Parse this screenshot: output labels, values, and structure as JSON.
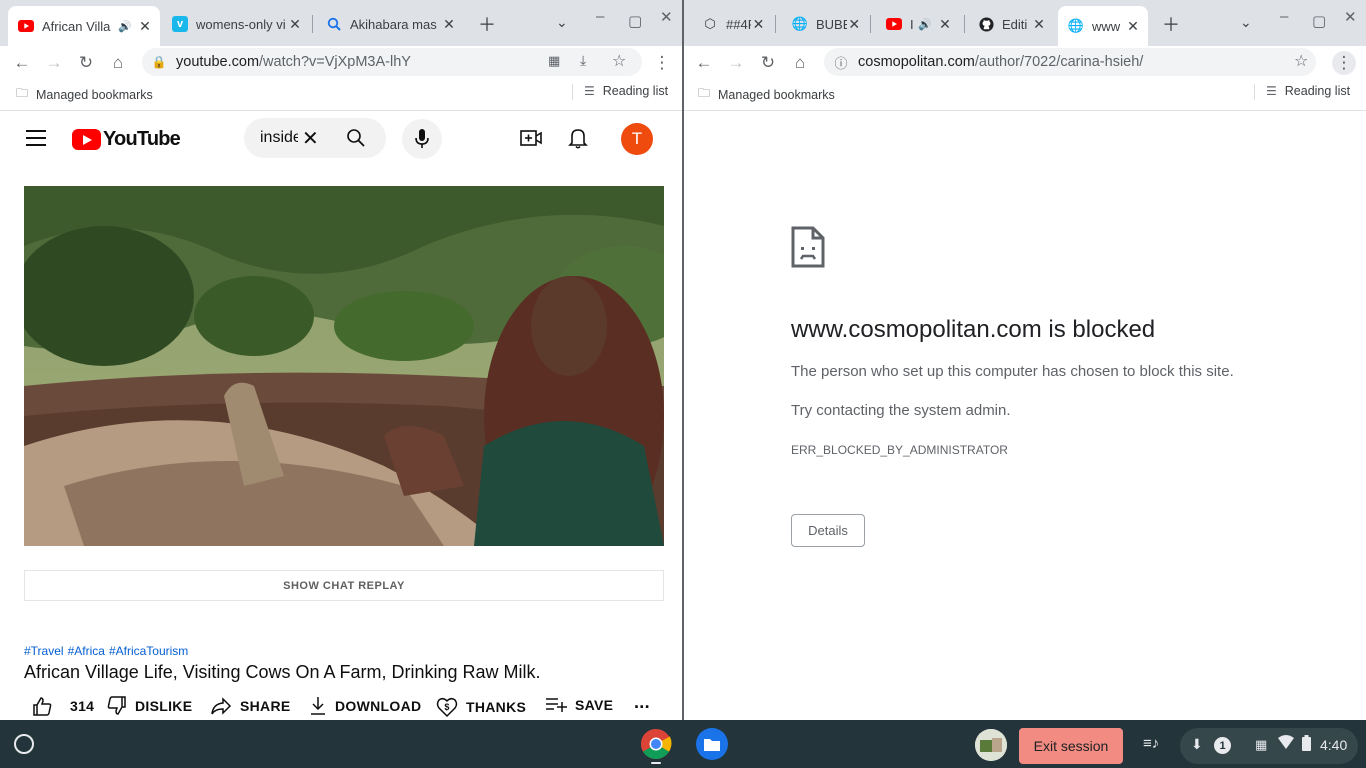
{
  "left_window": {
    "tabs": [
      {
        "title": "African Villa",
        "favicon": "youtube-icon",
        "sound": true,
        "active": true
      },
      {
        "title": "womens-only vi",
        "favicon": "vimeo-icon",
        "sound": false,
        "active": false
      },
      {
        "title": "Akihabara mas",
        "favicon": "search-icon",
        "sound": false,
        "active": false
      }
    ],
    "address": {
      "host": "youtube.com",
      "path": "/watch?v=VjXpM3A-lhY"
    },
    "bookmarks": {
      "managed": "Managed bookmarks",
      "reading_list": "Reading list"
    },
    "youtube": {
      "logo_text": "YouTube",
      "search_query": "inside",
      "avatar_letter": "T",
      "chat_replay": "SHOW CHAT REPLAY",
      "hashtags": [
        "#Travel",
        "#Africa",
        "#AfricaTourism"
      ],
      "video_title": "African Village Life, Visiting Cows On A Farm, Drinking Raw Milk.",
      "actions": {
        "likes": "314",
        "dislike": "DISLIKE",
        "share": "SHARE",
        "download": "DOWNLOAD",
        "thanks": "THANKS",
        "save": "SAVE",
        "more": "..."
      }
    }
  },
  "right_window": {
    "tabs": [
      {
        "title": "##4F",
        "favicon": "codepen-icon",
        "active": false
      },
      {
        "title": "BUBB",
        "favicon": "globe-icon",
        "active": false
      },
      {
        "title": "I",
        "favicon": "youtube-icon",
        "sound": true,
        "active": false
      },
      {
        "title": "Editi",
        "favicon": "github-icon",
        "active": false
      },
      {
        "title": "www",
        "favicon": "globe-icon",
        "active": true
      }
    ],
    "address": {
      "host": "cosmopolitan.com",
      "path": "/author/7022/carina-hsieh/"
    },
    "bookmarks": {
      "managed": "Managed bookmarks",
      "reading_list": "Reading list"
    },
    "blocked": {
      "title": "www.cosmopolitan.com is blocked",
      "message": "The person who set up this computer has chosen to block this site.",
      "hint": "Try contacting the system admin.",
      "code": "ERR_BLOCKED_BY_ADMINISTRATOR",
      "details_button": "Details"
    }
  },
  "shelf": {
    "exit_session": "Exit session",
    "notification_count": "1",
    "time": "4:40"
  },
  "colors": {
    "youtube_red": "#ff0000",
    "avatar": "#ef4b0f",
    "exit_button": "#f28b82",
    "shelf_bg": "#23353a"
  }
}
